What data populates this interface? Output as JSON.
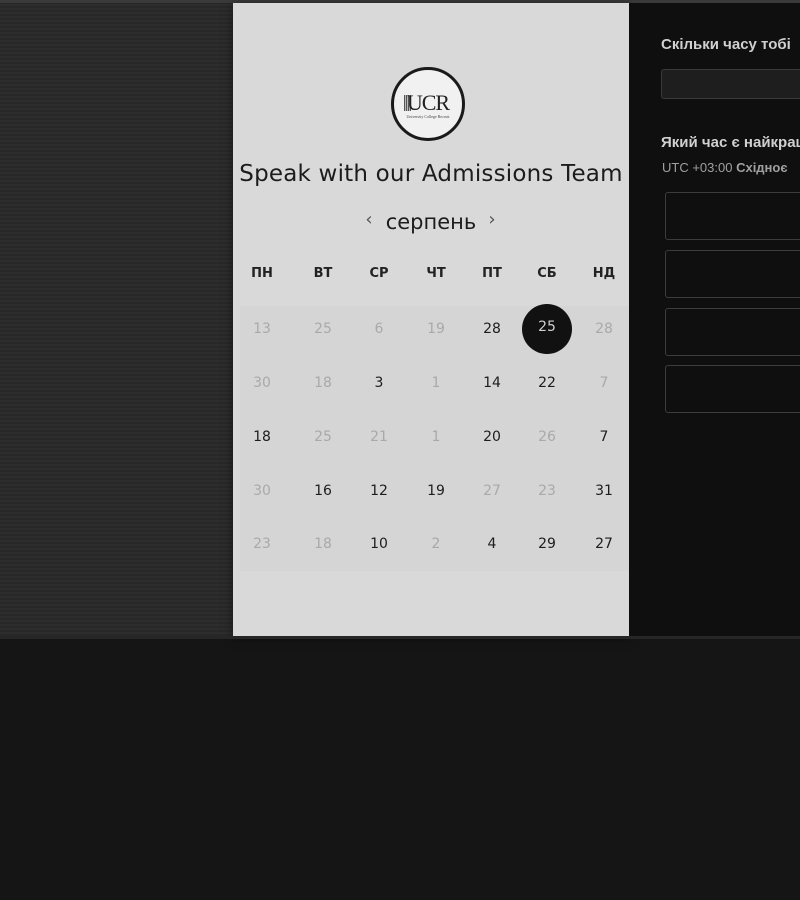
{
  "booking": {
    "logo": {
      "text": "UCR",
      "subtitle": "University College Recruit"
    },
    "title": "Speak with our Admissions Team",
    "month": "серпень",
    "weekdays": [
      "ПН",
      "ВТ",
      "СР",
      "ЧТ",
      "ПТ",
      "СБ",
      "НД"
    ],
    "days": [
      [
        "13",
        "25",
        "6",
        "19",
        "28",
        "25",
        "28"
      ],
      [
        "30",
        "18",
        "3",
        "1",
        "14",
        "22",
        "7"
      ],
      [
        "18",
        "25",
        "21",
        "1",
        "20",
        "26",
        "7"
      ],
      [
        "30",
        "16",
        "12",
        "19",
        "27",
        "23",
        "31"
      ],
      [
        "23",
        "18",
        "10",
        "2",
        "4",
        "29",
        "27"
      ]
    ],
    "disabled_days": [
      [
        true,
        true,
        true,
        true,
        false,
        false,
        true
      ],
      [
        true,
        true,
        false,
        true,
        false,
        false,
        true
      ],
      [
        false,
        true,
        true,
        true,
        false,
        true,
        false
      ],
      [
        true,
        false,
        false,
        false,
        true,
        true,
        false
      ],
      [
        true,
        true,
        false,
        true,
        false,
        false,
        false
      ]
    ],
    "selected_day": {
      "row": 0,
      "col": 5
    },
    "prev_icon": "chevron-left-icon",
    "next_icon": "chevron-right-icon"
  },
  "side_panel": {
    "duration_label": "Скільки часу тобі",
    "best_time_label": "Який час є найкращ",
    "timezone_prefix": "UTC +03:00",
    "timezone_name": "Східноє",
    "time_slots": [
      "",
      "",
      "",
      ""
    ]
  },
  "colors": {
    "card_bg": "#d9d9d9",
    "selected": "#111111",
    "panel_bg": "#0f0f0f"
  }
}
